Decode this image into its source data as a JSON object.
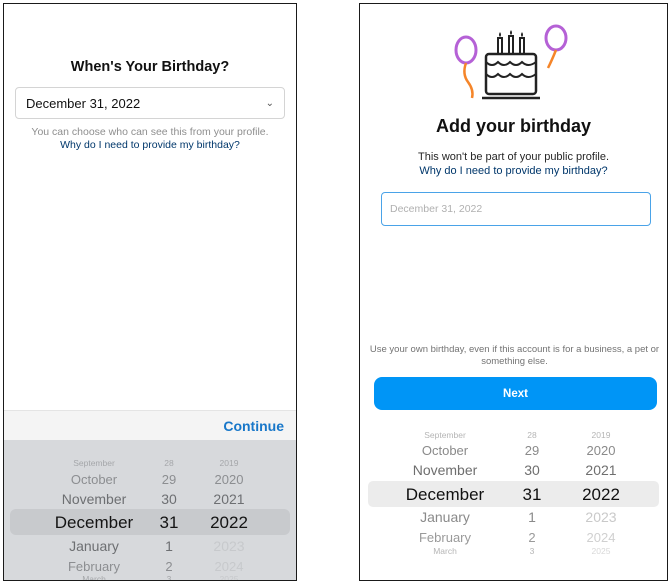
{
  "left": {
    "title": "When's Your Birthday?",
    "select_value": "December 31, 2022",
    "hint_line1": "You can choose who can see this from your profile.",
    "why_link": "Why do I need to provide my birthday?",
    "continue_label": "Continue",
    "picker": {
      "months": [
        "September",
        "October",
        "November",
        "December",
        "January",
        "February",
        "March"
      ],
      "days": [
        "28",
        "29",
        "30",
        "31",
        "1",
        "2",
        "3"
      ],
      "years": [
        "2019",
        "2020",
        "2021",
        "2022",
        "2023",
        "2024",
        "2025"
      ],
      "selected": {
        "month": "December",
        "day": "31",
        "year": "2022"
      }
    }
  },
  "right": {
    "title": "Add your birthday",
    "subtitle": "This won't be part of your public profile.",
    "why_link": "Why do I need to provide my birthday?",
    "input_placeholder": "December 31, 2022",
    "note": "Use your own birthday, even if this account is for a business, a pet or something else.",
    "next_label": "Next",
    "picker": {
      "months": [
        "September",
        "October",
        "November",
        "December",
        "January",
        "February",
        "March"
      ],
      "days": [
        "28",
        "29",
        "30",
        "31",
        "1",
        "2",
        "3"
      ],
      "years": [
        "2019",
        "2020",
        "2021",
        "2022",
        "2023",
        "2024",
        "2025"
      ],
      "selected": {
        "month": "December",
        "day": "31",
        "year": "2022"
      }
    }
  },
  "colors": {
    "link": "#00376b",
    "continue": "#1877c9",
    "next_button": "#0095f6",
    "input_focus": "#4aa3e8",
    "balloon_purple": "#b561d6",
    "balloon_orange": "#f58529"
  },
  "icons": [
    "chevron-down-icon",
    "birthday-cake-icon",
    "balloon-icon"
  ]
}
